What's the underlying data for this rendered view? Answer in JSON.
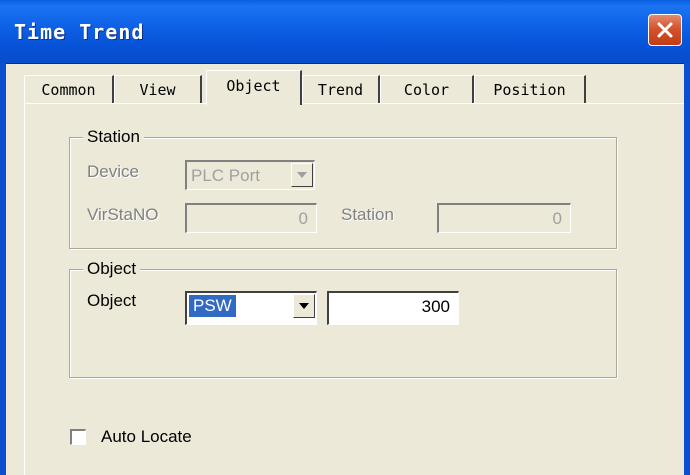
{
  "window": {
    "title": "Time Trend"
  },
  "tabs": [
    {
      "label": "Common",
      "active": false
    },
    {
      "label": "View",
      "active": false
    },
    {
      "label": "Object",
      "active": true
    },
    {
      "label": "Trend",
      "active": false
    },
    {
      "label": "Color",
      "active": false
    },
    {
      "label": "Position",
      "active": false
    }
  ],
  "station_group": {
    "title": "Station",
    "device_label": "Device",
    "device_value": "PLC Port",
    "virstano_label": "VirStaNO",
    "virstano_value": "0",
    "station_label": "Station",
    "station_value": "0"
  },
  "object_group": {
    "title": "Object",
    "object_label": "Object",
    "object_type": "PSW",
    "object_address": "300"
  },
  "auto_locate": {
    "label": "Auto Locate",
    "checked": false
  },
  "colors": {
    "titlebar": "#0a5fe0",
    "dialog_bg": "#ece9d8",
    "selection": "#316ac5",
    "close": "#d3542d"
  },
  "icons": {
    "close": "close-icon",
    "dropdown": "chevron-down-icon"
  }
}
